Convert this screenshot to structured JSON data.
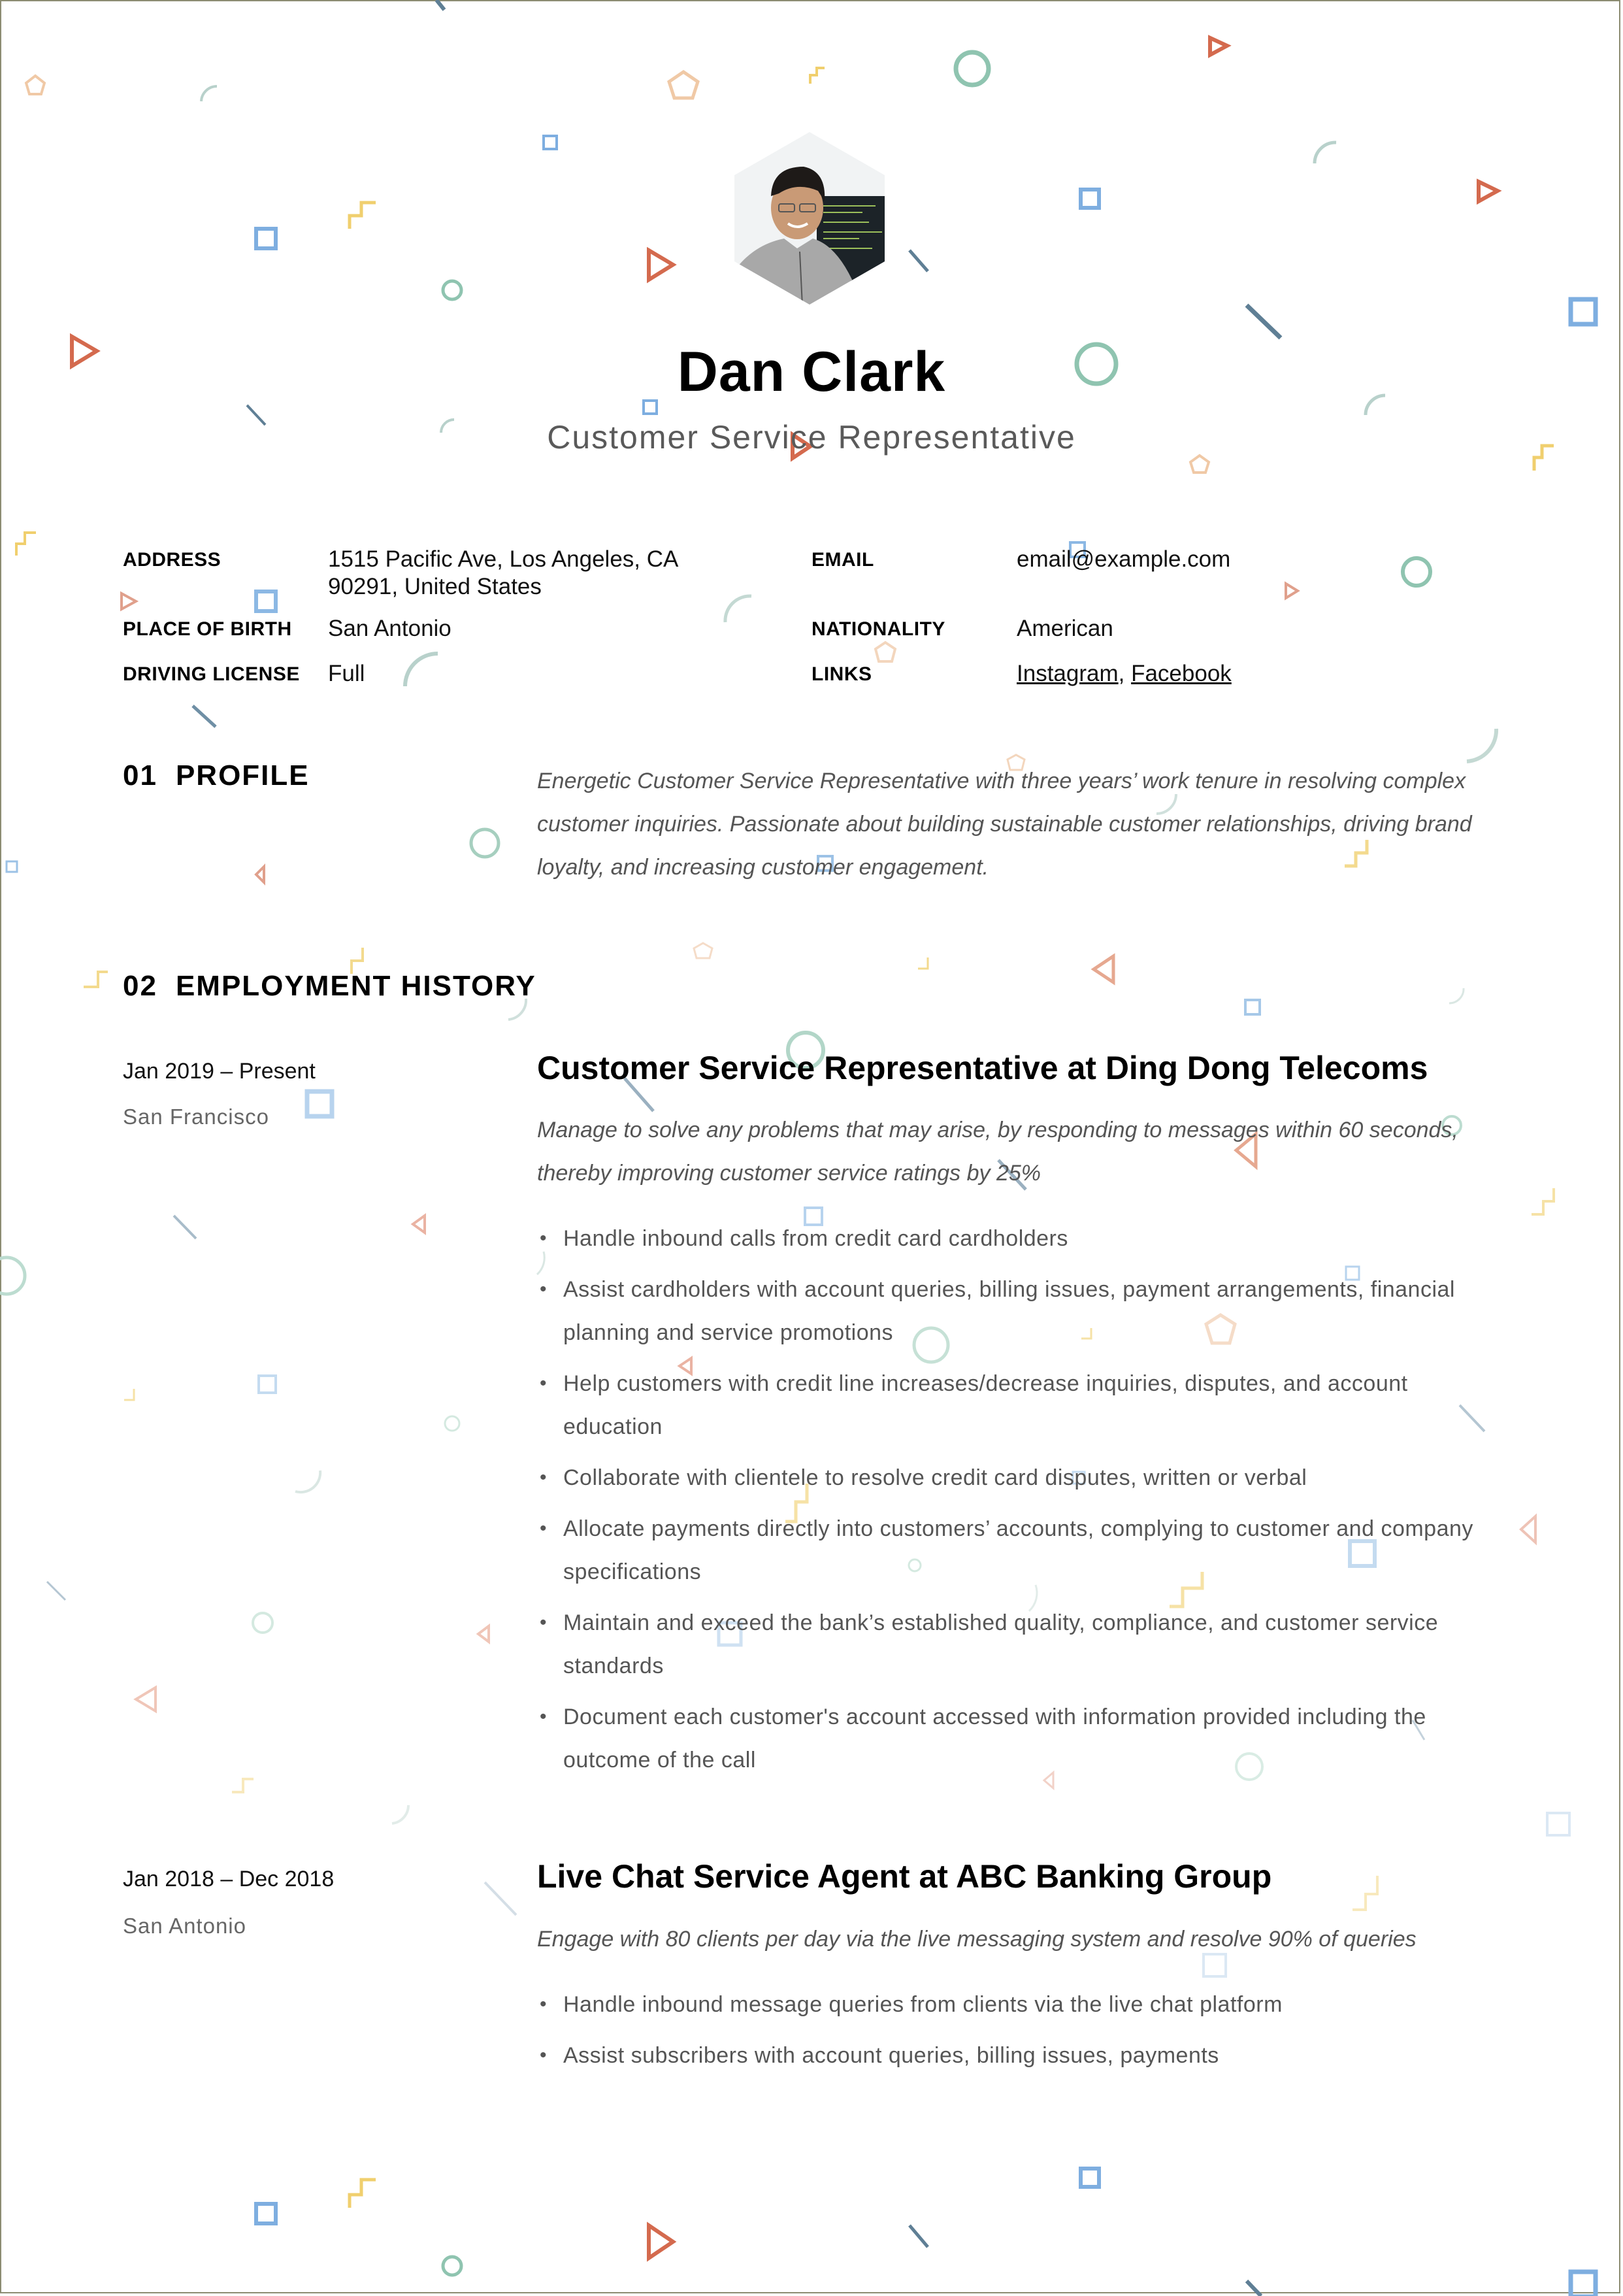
{
  "header": {
    "name": "Dan Clark",
    "role": "Customer Service Representative",
    "photo_alt": "Profile photo of Dan Clark"
  },
  "details": {
    "left": [
      {
        "label": "ADDRESS",
        "value_line1": "1515 Pacific Ave, Los Angeles, CA",
        "value_line2": "90291, United States"
      },
      {
        "label": "PLACE OF BIRTH",
        "value": "San Antonio"
      },
      {
        "label": "DRIVING LICENSE",
        "value": "Full"
      }
    ],
    "right": [
      {
        "label": "EMAIL",
        "value": "email@example.com"
      },
      {
        "label": "NATIONALITY",
        "value": "American"
      },
      {
        "label": "LINKS",
        "links": [
          "Instagram",
          "Facebook"
        ],
        "separator": ", "
      }
    ]
  },
  "profile": {
    "number": "01",
    "title": "PROFILE",
    "text": "Energetic Customer Service Representative with three years’ work tenure in resolving complex customer inquiries. Passionate about building sustainable customer relationships, driving brand loyalty, and increasing customer engagement."
  },
  "employment": {
    "number": "02",
    "title": "EMPLOYMENT HISTORY",
    "jobs": [
      {
        "dates": "Jan 2019 – Present",
        "city": "San Francisco",
        "title": "Customer Service Representative at Ding Dong Telecoms",
        "description": "Manage to solve any problems that may arise, by responding to messages within 60 seconds, thereby improving customer service ratings by 25%",
        "bullets": [
          "Handle inbound calls from credit card cardholders",
          "Assist cardholders with account queries, billing issues, payment arrangements, financial planning and service promotions",
          "Help customers with credit line increases/decrease inquiries, disputes, and account education",
          "Collaborate with clientele to resolve credit card disputes, written or verbal",
          "Allocate payments directly into customers’ accounts, complying to customer and company specifications",
          "Maintain and exceed the bank’s established quality, compliance, and customer service standards",
          "Document each customer's account accessed with information provided including the outcome of the call"
        ]
      },
      {
        "dates": "Jan 2018 – Dec 2018",
        "city": "San Antonio",
        "title": "Live Chat Service Agent at ABC Banking Group",
        "description": "Engage with 80 clients per day via the live messaging system and resolve 90% of queries",
        "bullets": [
          "Handle inbound message queries from clients via the live chat platform",
          "Assist subscribers with account queries, billing issues, payments"
        ]
      }
    ]
  },
  "colors": {
    "orange": "#d46a4e",
    "blue": "#7eaee0",
    "green": "#8fc4b0",
    "yellow": "#f0cf6e",
    "peach": "#f0c9a6",
    "slate": "#5f7f95",
    "sage": "#b8d1cb",
    "border": "#8c8c72"
  }
}
